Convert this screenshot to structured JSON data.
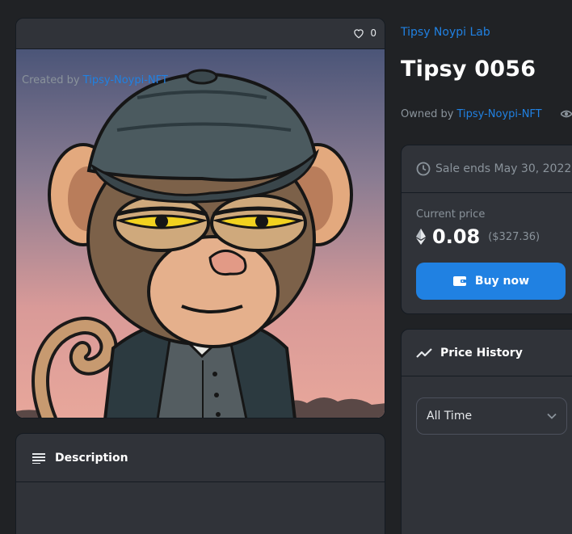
{
  "item": {
    "favorites_count": "0",
    "collection_name": "Tipsy Noypi Lab",
    "title": "Tipsy 0056",
    "owned_by_label": "Owned by",
    "owner_name": "Tipsy-Noypi-NFT"
  },
  "description": {
    "header": "Description",
    "created_by_label": "Created by",
    "creator_name": "Tipsy-Noypi-NFT"
  },
  "sale": {
    "ends_text": "Sale ends May 30, 2022",
    "current_price_label": "Current price",
    "price_eth": "0.08",
    "price_usd": "($327.36)",
    "buy_label": "Buy now"
  },
  "price_history": {
    "header": "Price History",
    "period_selected": "All Time"
  },
  "icons": {
    "favorite": "heart-icon",
    "views": "eye-icon",
    "description": "list-lines-icon",
    "clock": "clock-icon",
    "currency": "ethereum-icon",
    "wallet": "wallet-icon",
    "trend": "trend-line-icon",
    "dropdown": "chevron-down-icon"
  },
  "colors": {
    "accent": "#2081e2",
    "background": "#202225",
    "panel": "#303339"
  }
}
